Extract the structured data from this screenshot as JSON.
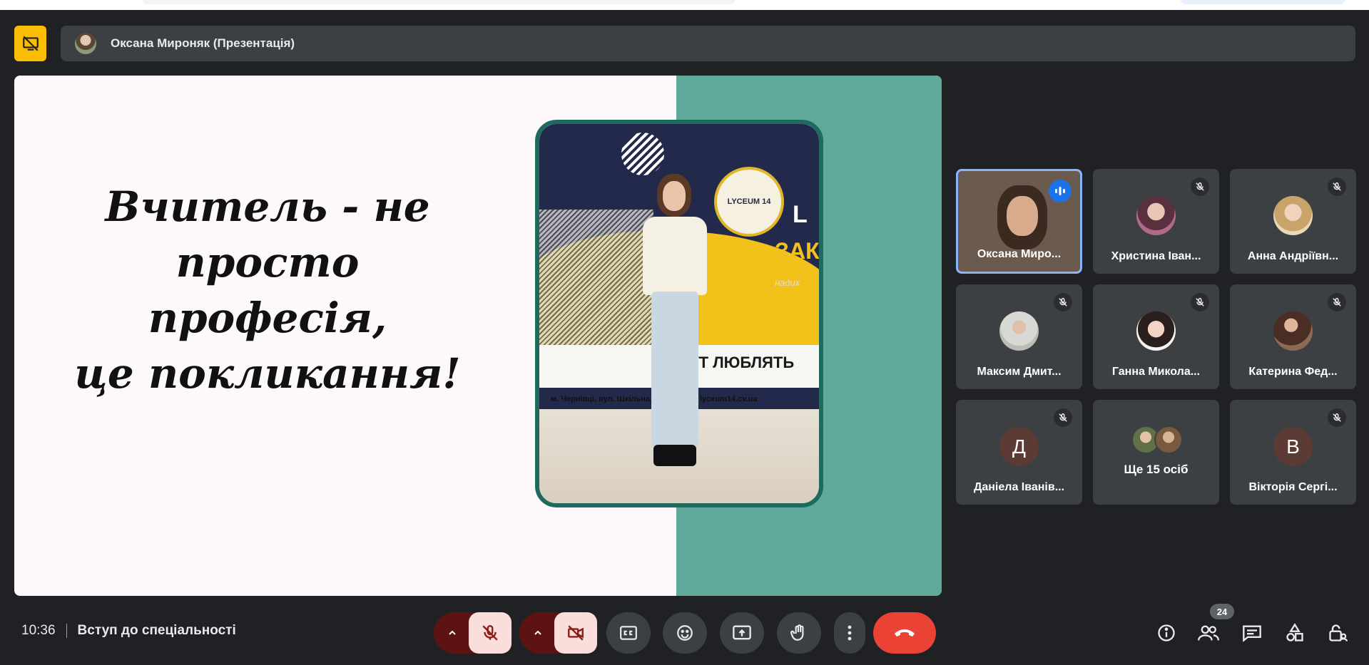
{
  "presenter_bar": {
    "title": "Оксана Мироняк (Презентація)"
  },
  "slide": {
    "quote_line1": "Вчитель - не просто",
    "quote_line2": "професія,",
    "quote_line3": "це покликання!",
    "photo_banner_text": "УТ ЛЮБЛЯТЬ",
    "photo_banner_big": "ЗАК",
    "photo_banner_letter": "L",
    "photo_banner_small": "надих",
    "photo_logo": "LYCEUM 14",
    "photo_address": "м. Чернівці, вул. Шкільна, 3",
    "photo_site": "lyceum14.cv.ua"
  },
  "participants": [
    {
      "name": "Оксана Миро...",
      "speaking": true
    },
    {
      "name": "Христина Іван...",
      "muted": true
    },
    {
      "name": "Анна Андріївн...",
      "muted": true
    },
    {
      "name": "Максим Дмит...",
      "muted": true
    },
    {
      "name": "Ганна Микола...",
      "muted": true
    },
    {
      "name": "Катерина Фед...",
      "muted": true
    },
    {
      "name": "Даніела Іванів...",
      "muted": true,
      "initial": "Д"
    },
    {
      "more_label": "Ще 15 осіб"
    },
    {
      "name": "Вікторія Сергі...",
      "muted": true,
      "initial": "В"
    }
  ],
  "footer": {
    "time": "10:36",
    "meeting_title": "Вступ до спеціальності",
    "people_count": "24"
  },
  "colors": {
    "background": "#202124",
    "tile": "#3c4043",
    "end_call": "#ea4335",
    "present_icon": "#fbbc04",
    "teal": "#5fa99a"
  }
}
